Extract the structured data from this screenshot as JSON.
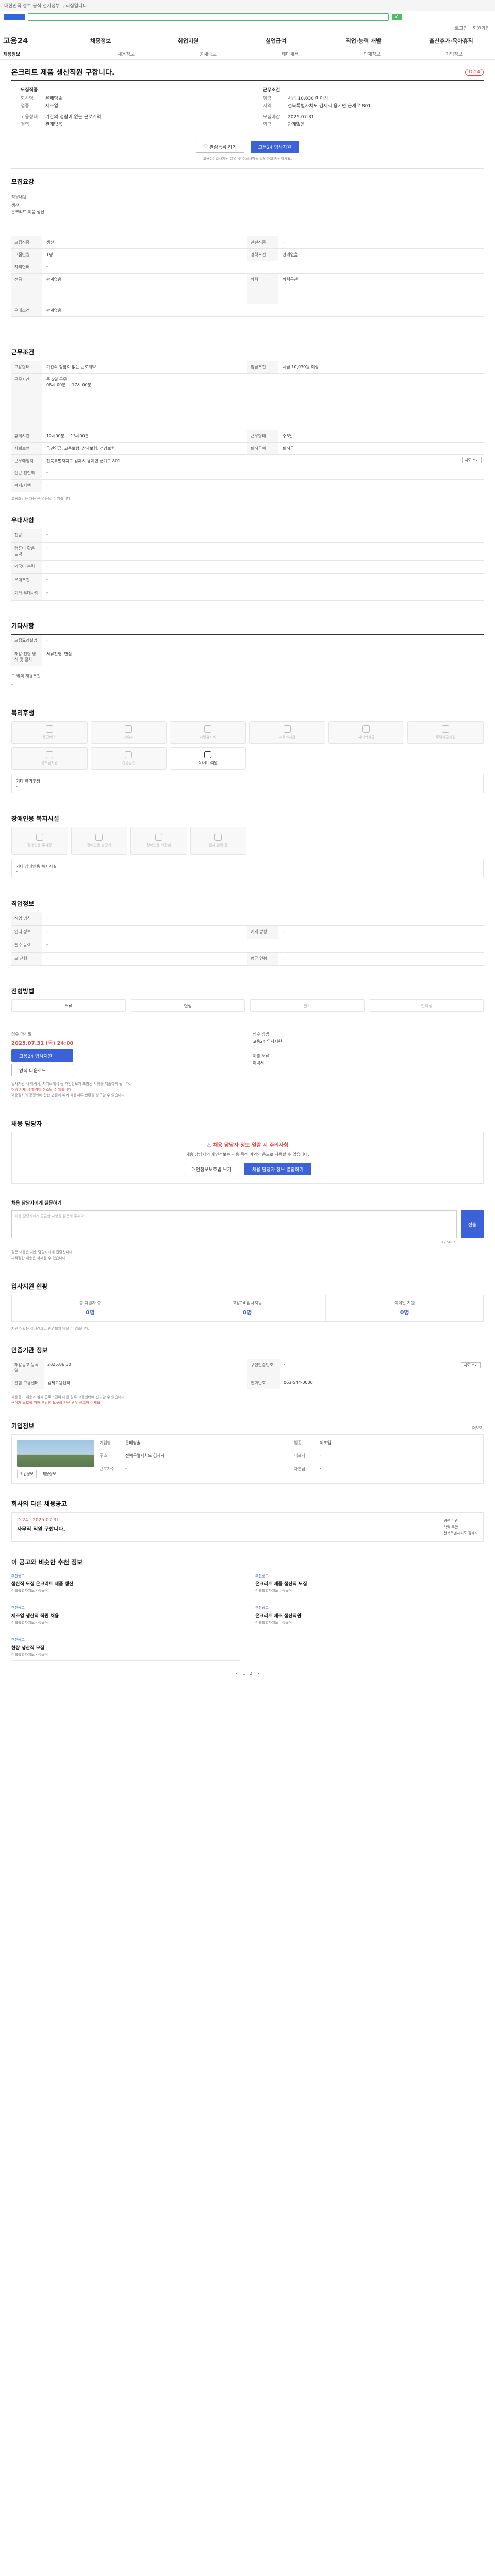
{
  "topbar": {
    "notice": "대한민국 정부 공식 전자정부 누리집입니다."
  },
  "util": [
    "로그인",
    "회원가입"
  ],
  "gnb": {
    "brand": "고용24",
    "items": [
      "채용정보",
      "취업지원",
      "실업급여",
      "직업·능력 개발",
      "출산휴가·육아휴직"
    ]
  },
  "lnb": [
    "채용정보",
    "채용정보",
    "공채속보",
    "테마채용",
    "인재정보",
    "기업정보"
  ],
  "job": {
    "title": "온크리트 제품 생산직원 구합니다.",
    "status": "D-24",
    "recruit_company_label": "모집직종",
    "company_name_label": "회사명",
    "company_name": "온메딩솔",
    "field_label": "업종",
    "field": "제조업",
    "conditions_label": "근무조건",
    "salary_label": "임금",
    "salary": "시급 10,030원 이상",
    "region_label": "지역",
    "region": "전북특별자치도 김제시 용지면 군계로 801",
    "worktype_label": "고용형태",
    "worktype": "기간의 정함이 없는 근로계약",
    "career_label": "경력",
    "career": "관계없음",
    "edu_label": "학력",
    "edu": "관계없음",
    "deadline_label": "모집마감",
    "deadline": "2025.07.31",
    "btn_interest": "관심등록 하기",
    "btn_apply": "고용24 입사지원",
    "apply_note": "고용24 입사지원 설명 및 주의사항을 확인하고 지원하세요."
  },
  "s1": {
    "title": "모집요강",
    "job_desc_label": "직무내용",
    "job_desc_lines": [
      "생산",
      "온크리트 제품 생산"
    ],
    "rows": [
      {
        "k": "모집직종",
        "v": "생산",
        "k2": "관련직종",
        "v2": "-"
      },
      {
        "k": "모집인원",
        "v": "1명",
        "k2": "경력조건",
        "v2": "관계없음"
      },
      {
        "k": "자격면허",
        "v": "-",
        "k2": "",
        "v2": ""
      },
      {
        "k": "전공",
        "v": "관계없음",
        "k2": "학력",
        "v2": "학력무관"
      },
      {
        "k": "우대조건",
        "v": "관계없음",
        "k2": "",
        "v2": ""
      }
    ]
  },
  "s2": {
    "title": "근무조건",
    "rows": [
      {
        "k": "고용형태",
        "v": "기간의 정함이 없는 근로계약",
        "k2": "임금조건",
        "v2": "시급 10,030원 이상"
      },
      {
        "k": "근무시간",
        "v": "주 5일 근무",
        "k2": "",
        "v2": ""
      },
      {
        "k": "휴게시간",
        "v": "12시00분 ~ 13시00분",
        "k2": "근무형태",
        "v2": "주5일"
      },
      {
        "k": "사회보험",
        "v": "국민연금, 고용보험, 산재보험, 건강보험",
        "k2": "퇴직급여",
        "v2": "퇴직금"
      },
      {
        "k": "근무예정지",
        "v": "전북특별자치도 김제시 용지면 군계로 801",
        "k2": "",
        "v2": ""
      },
      {
        "k": "인근 전철역",
        "v": "-",
        "k2": "",
        "v2": ""
      },
      {
        "k": "복지/사택",
        "v": "-",
        "k2": "",
        "v2": ""
      }
    ],
    "schedule": [
      "08시 00분 ~ 17시 00분"
    ],
    "note": "고용조건은 채용 전 변동될 수 있습니다."
  },
  "s3": {
    "title": "우대사항",
    "rows": [
      {
        "k": "전공",
        "v": "-"
      },
      {
        "k": "컴퓨터 활용 능력",
        "v": "-"
      },
      {
        "k": "외국어 능력",
        "v": "-"
      },
      {
        "k": "우대조건",
        "v": "-"
      },
      {
        "k": "기타 우대사항",
        "v": "-"
      }
    ]
  },
  "s4": {
    "title": "기타사항",
    "rows": [
      {
        "k": "모집요강설명",
        "v": "-"
      },
      {
        "k": "채용·전형 방식 및 절차",
        "v": "서류전형, 면접"
      }
    ],
    "desc_k": "그 밖의 채용조건",
    "desc_v": "-"
  },
  "s5": {
    "title": "복리후생",
    "items": [
      "통근버스",
      "기숙사",
      "차량유지비",
      "교육비지원",
      "자녀학자금",
      "주택자금지원",
      "경조금지원",
      "건강검진",
      "식사(비)지원"
    ],
    "etc_k": "기타 복리후생",
    "etc_v": "-"
  },
  "s6": {
    "title": "장애인용 복지시설",
    "items": [
      "장애인용 주차장",
      "장애인용 승강기",
      "장애인용 화장실",
      "점자 블록 등"
    ],
    "etc_k": "기타 장애인용 복지시설",
    "etc_v": "-"
  },
  "s7": {
    "title": "직업정보",
    "rows": [
      {
        "k": "직업 명칭",
        "v": "-",
        "k2": "",
        "v2": ""
      },
      {
        "k": "인터 정보",
        "v": "-",
        "k2": "에게 방향",
        "v2": "-"
      },
      {
        "k": "필수 능력",
        "v": "-",
        "k2": "",
        "v2": ""
      },
      {
        "k": "모 전형",
        "v": "-",
        "k2": "평균 연봉",
        "v2": "-"
      }
    ]
  },
  "s8": {
    "title": "전형방법",
    "methods": [
      "서류",
      "면접",
      "필기",
      "인적성"
    ],
    "deadline_k": "접수 마감일",
    "deadline_v": "2025.07.31 (목) 24:00",
    "method_k": "접수 방법",
    "method_v": "고용24 입사지원",
    "form_k": "제출 서류",
    "form_v": "이력서",
    "apply_btn": "고용24 입사지원",
    "docs_btn": "양식 다운로드",
    "bullets": [
      "입사지원 시 이력서, 자기소개서 등 개인정보가 포함된 서류를 제출하게 됩니다.",
      "허위 기재 시 합격이 취소될 수 있습니다.",
      "채용절차의 공정화에 관한 법률에 따라 채용서류 반환을 청구할 수 있습니다."
    ]
  },
  "s9": {
    "title": "채용 담당자",
    "warn": "채용 담당자 정보 열람 시 주의사항",
    "desc": "채용 담당자의 개인정보는 채용 목적 이외의 용도로 사용할 수 없습니다.",
    "btn1": "개인정보보호법 보기",
    "btn2": "채용 담당자 정보 열람하기"
  },
  "s10": {
    "title": "채용 담당자에게 질문하기",
    "placeholder": "채용 담당자에게 궁금한 사항을 질문해 주세요.",
    "counter": "0 / 500자",
    "btn": "전송",
    "bullets": [
      "질문 내용은 채용 담당자에게 전달됩니다.",
      "부적절한 내용은 삭제될 수 있습니다."
    ]
  },
  "s11": {
    "title": "입사지원 현황",
    "cells": [
      {
        "k": "총 지원자 수",
        "v": "0명"
      },
      {
        "k": "고용24 입사지원",
        "v": "0명"
      },
      {
        "k": "이메일 지원",
        "v": "0명"
      }
    ],
    "note": "지원 현황은 실시간으로 반영되지 않을 수 있습니다."
  },
  "s12": {
    "title": "인증기관 정보",
    "rows": [
      {
        "k": "채용공고 등록일",
        "v": "2025.06.30",
        "k2": "구인인증번호",
        "v2": "-"
      },
      {
        "k": "관할 고용센터",
        "v": "김제고용센터",
        "k2": "전화번호",
        "v2": "063-544-0000"
      }
    ],
    "btn": "지도 보기",
    "bullets": [
      "채용공고 내용과 실제 근로조건이 다를 경우 고용센터에 신고할 수 있습니다.",
      "구직자 보호를 위해 부당한 요구를 받은 경우 신고해 주세요."
    ]
  },
  "s13": {
    "title": "기업정보",
    "more": "더보기",
    "company_name": "온메딩솔",
    "kv": [
      {
        "k": "기업명",
        "v": "온메딩솔"
      },
      {
        "k": "업종",
        "v": "제조업"
      },
      {
        "k": "주소",
        "v": "전북특별자치도 김제시"
      },
      {
        "k": "대표자",
        "v": "-"
      },
      {
        "k": "근로자수",
        "v": "-"
      },
      {
        "k": "자본금",
        "v": "-"
      }
    ],
    "btns": [
      "기업정보",
      "채용정보"
    ]
  },
  "s14": {
    "title": "회사의 다른 채용공고",
    "d": "D-24",
    "date": "2025.07.31",
    "t": "사무직 직원 구합니다.",
    "meta": [
      "경력 무관",
      "학력 무관",
      "전북특별자치도 김제시"
    ]
  },
  "s15": {
    "title": "이 공고와 비슷한 추천 정보",
    "items": [
      {
        "tag": "추천공고",
        "t": "생산직 모집 온크리트 제품 생산",
        "m": "전북특별자치도 · 정규직"
      },
      {
        "tag": "추천공고",
        "t": "온크리트 제품 생산직 모집",
        "m": "전북특별자치도 · 정규직"
      },
      {
        "tag": "추천공고",
        "t": "제조업 생산직 직원 채용",
        "m": "전북특별자치도 · 정규직"
      },
      {
        "tag": "추천공고",
        "t": "온크리트 제조 생산직원",
        "m": "전북특별자치도 · 정규직"
      },
      {
        "tag": "추천공고",
        "t": "현장 생산직 모집",
        "m": "전북특별자치도 · 정규직"
      }
    ]
  },
  "pager": [
    "<",
    "1",
    "2",
    ">"
  ]
}
